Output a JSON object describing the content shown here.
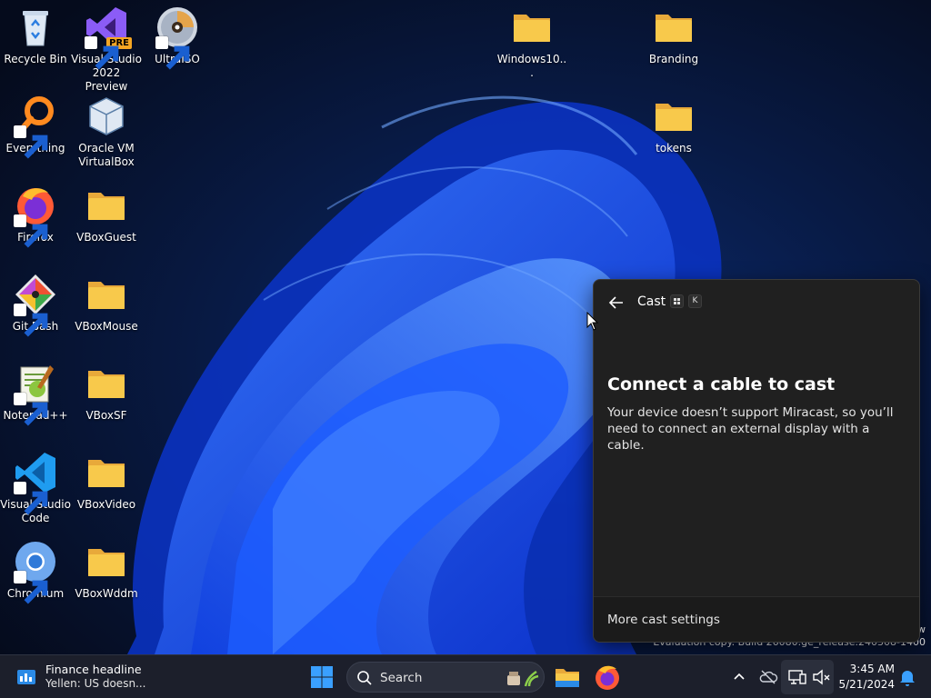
{
  "desktop": {
    "icons": [
      {
        "label": "Recycle Bin"
      },
      {
        "label": "Visual Studio 2022 Preview",
        "badge": "PRE"
      },
      {
        "label": "UltraISO"
      },
      {
        "label": "Everything"
      },
      {
        "label": "Oracle VM VirtualBox"
      },
      {
        "label": "Firefox"
      },
      {
        "label": "VBoxGuest"
      },
      {
        "label": "Git Bash"
      },
      {
        "label": "VBoxMouse"
      },
      {
        "label": "Notepad++"
      },
      {
        "label": "VBoxSF"
      },
      {
        "label": "Visual Studio Code"
      },
      {
        "label": "VBoxVideo"
      },
      {
        "label": "Chromium"
      },
      {
        "label": "VBoxWddm"
      },
      {
        "label": "Windows10..."
      },
      {
        "label": "Branding"
      },
      {
        "label": "tokens"
      }
    ]
  },
  "watermark": {
    "line1": "w",
    "line2": "Evaluation copy. Build 26080.ge_release.240308-1400"
  },
  "cast_panel": {
    "title": "Cast",
    "shortcut_key": "K",
    "heading": "Connect a cable to cast",
    "description": "Your device doesn’t support Miracast, so you’ll need to connect an external display with a cable.",
    "settings_link": "More cast settings"
  },
  "taskbar": {
    "widget_title": "Finance headline",
    "widget_subtitle": "Yellen: US doesn...",
    "search_label": "Search",
    "clock_time": "3:45 AM",
    "clock_date": "5/21/2024"
  },
  "colors": {
    "accent": "#0a5bff",
    "folder": "#f8c94b",
    "panel_bg": "#202020",
    "taskbar_bg": "#1c1f2b"
  }
}
